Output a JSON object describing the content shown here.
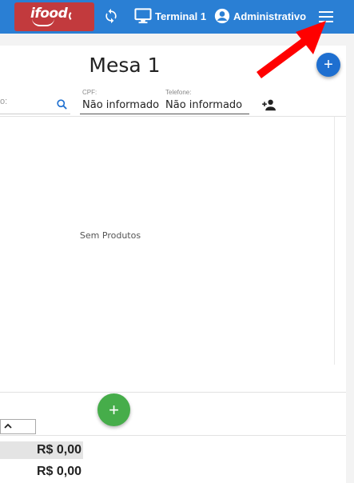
{
  "header": {
    "brand": "ifood",
    "terminal_label": "Terminal 1",
    "user_label": "Administrativo",
    "accent_color": "#2a7fd4",
    "brand_color": "#c23a3d",
    "icons": [
      "sync-icon",
      "monitor-icon",
      "user-circle-icon",
      "menu-icon"
    ]
  },
  "table": {
    "title": "Mesa 1",
    "partial_field_label": "o:",
    "cpf_label": "CPF:",
    "cpf_value": "Não informado",
    "phone_label": "Telefone:",
    "phone_value": "Não informado"
  },
  "products": {
    "empty_text": "Sem Produtos"
  },
  "totals": {
    "row1": "R$ 0,00",
    "row2": "R$ 0,00"
  },
  "colors": {
    "add_top": "#1e6fd0",
    "add_bottom": "#46ad4a",
    "annotation_arrow": "#ff0000"
  }
}
